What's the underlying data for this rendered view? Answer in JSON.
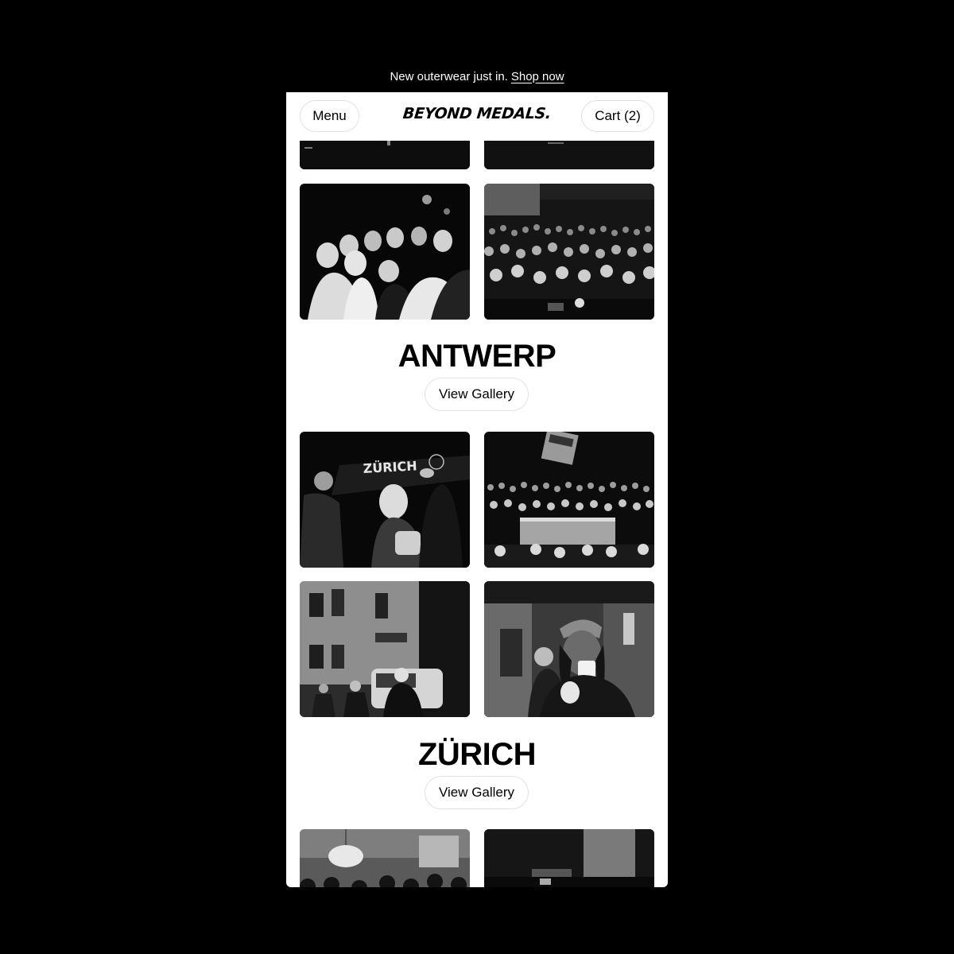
{
  "announcement": {
    "text": "New outerwear just in.",
    "link_label": "Shop now"
  },
  "header": {
    "menu_label": "Menu",
    "logo_text": "BEYOND MEDALS.",
    "cart_label": "Cart (2)"
  },
  "sections": [
    {
      "city": "ANTWERP",
      "button_label": "View Gallery"
    },
    {
      "city": "ZÜRICH",
      "button_label": "View Gallery",
      "photo_sign_text": "ZÜRICH"
    }
  ],
  "colors": {
    "page_background": "#000000",
    "card_background": "#ffffff",
    "pill_border": "#e2e2e2"
  }
}
